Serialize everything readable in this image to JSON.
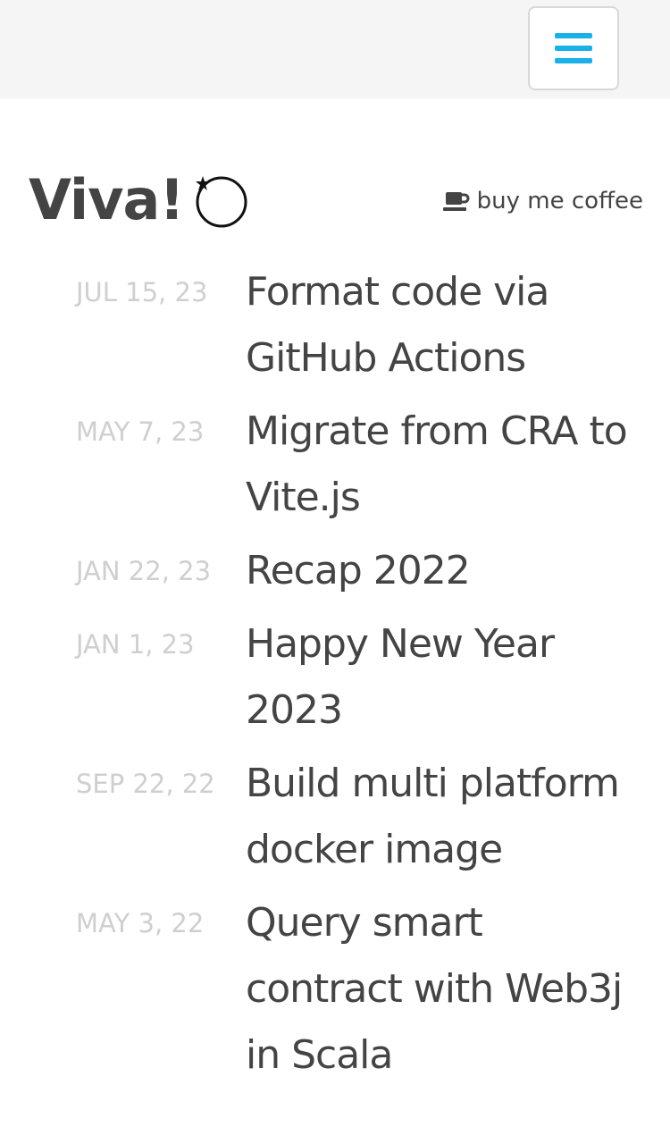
{
  "header": {
    "menu_icon": "hamburger-icon",
    "accent_color": "#1ab0e8"
  },
  "brand": {
    "title": "Viva!",
    "logo_icon": "orbit-star-icon"
  },
  "coffee": {
    "label": "buy me coffee",
    "icon": "coffee-cup-icon"
  },
  "posts": [
    {
      "date": "JUL 15, 23",
      "title": "Format code via GitHub Actions"
    },
    {
      "date": "MAY 7, 23",
      "title": "Migrate from CRA to Vite.js"
    },
    {
      "date": "JAN 22, 23",
      "title": "Recap 2022"
    },
    {
      "date": "JAN 1, 23",
      "title": "Happy New Year 2023"
    },
    {
      "date": "SEP 22, 22",
      "title": "Build multi platform docker image"
    },
    {
      "date": "MAY 3, 22",
      "title": "Query smart contract with Web3j in Scala"
    }
  ]
}
